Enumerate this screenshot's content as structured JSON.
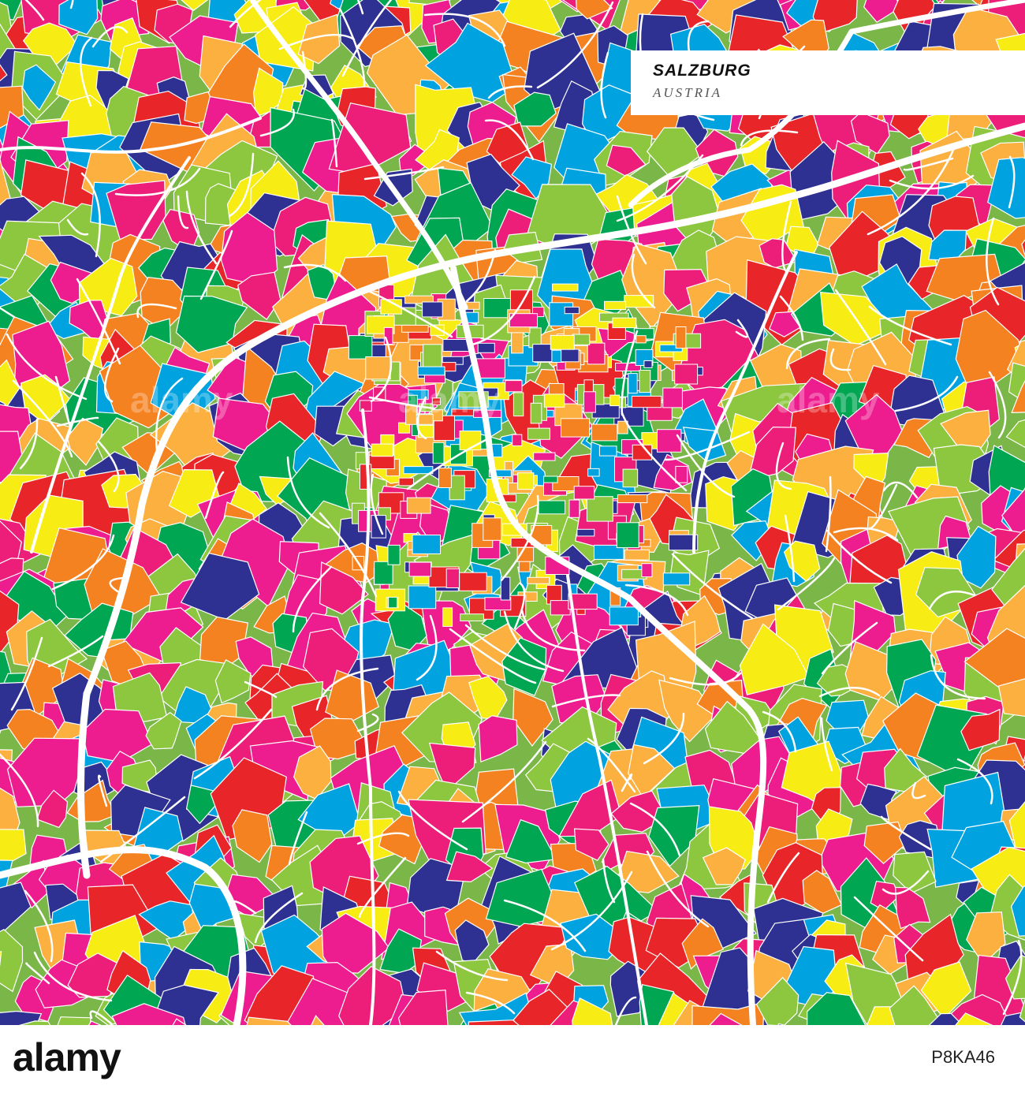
{
  "map": {
    "city": "SALZBURG",
    "country": "AUSTRIA",
    "palette": [
      "#e8262a",
      "#ec1e79",
      "#f7ec13",
      "#f58220",
      "#2e3192",
      "#00a3e0",
      "#00a651",
      "#8dc63f",
      "#ed1c8f",
      "#fbb040"
    ],
    "road_color": "#ffffff"
  },
  "watermark": {
    "text": "alamy"
  },
  "footer": {
    "logo": "alamy",
    "image_id": "P8KA46"
  }
}
